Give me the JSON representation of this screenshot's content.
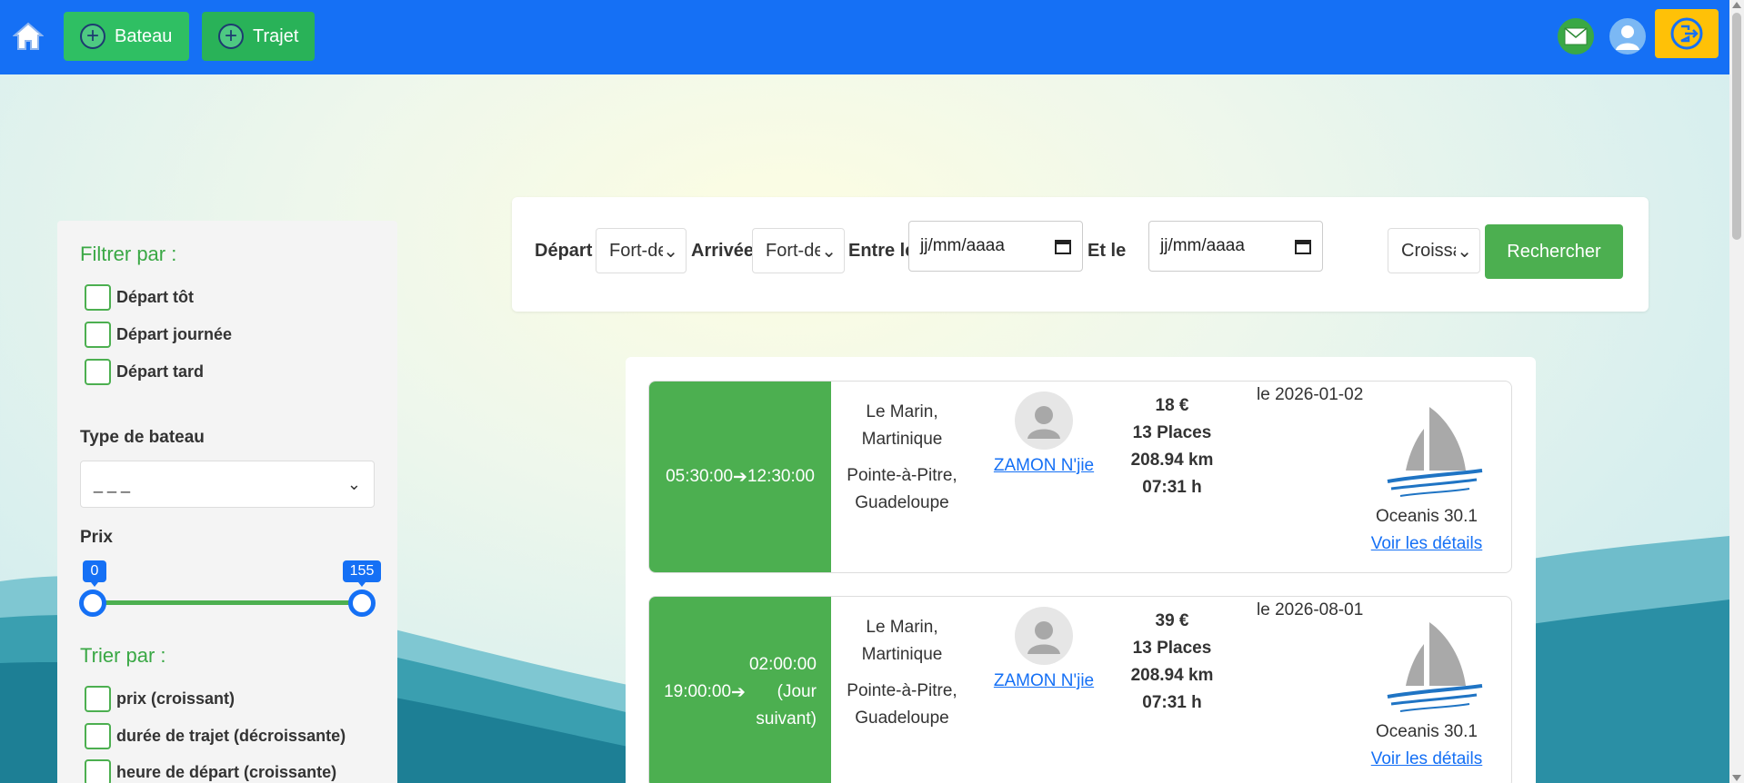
{
  "nav": {
    "bateau_label": "Bateau",
    "trajet_label": "Trajet"
  },
  "filters": {
    "title": "Filtrer par :",
    "checks": [
      "Départ tôt",
      "Départ journée",
      "Départ tard"
    ],
    "boat_type_label": "Type de bateau",
    "boat_type_value": "_ _ _",
    "price_label": "Prix",
    "price_min": "0",
    "price_max": "155"
  },
  "sort": {
    "title": "Trier par :",
    "checks": [
      "prix (croissant)",
      "durée de trajet (décroissante)",
      "heure de départ (croissante)"
    ]
  },
  "search": {
    "depart_label": "Départ",
    "depart_value": "Fort-de-France",
    "arrivee_label": "Arrivée",
    "arrivee_value": "Fort-de-France",
    "entre_label": "Entre le",
    "date_from_placeholder": "jj/mm/aaaa",
    "et_label": "Et le",
    "date_to_placeholder": "jj/mm/aaaa",
    "sort_value": "Croissant",
    "button_label": "Rechercher"
  },
  "trips": [
    {
      "depart_time": "05:30:00",
      "arrow": "➔",
      "arrival_time": "12:30:00",
      "from_city": "Le Marin,",
      "from_region": "Martinique",
      "to_city": "Pointe-à-Pitre,",
      "to_region": "Guadeloupe",
      "owner": "ZAMON N'jie",
      "price": "18 €",
      "places": "13 Places",
      "distance": "208.94 km",
      "duration": "07:31 h",
      "date": "le 2026-01-02",
      "boat": "Oceanis 30.1",
      "details": "Voir les détails"
    },
    {
      "depart_time": "19:00:00",
      "arrow": "➔",
      "arrival_time": "02:00:00",
      "arrival_note_1": "(Jour",
      "arrival_note_2": "suivant)",
      "from_city": "Le Marin,",
      "from_region": "Martinique",
      "to_city": "Pointe-à-Pitre,",
      "to_region": "Guadeloupe",
      "owner": "ZAMON N'jie",
      "price": "39 €",
      "places": "13 Places",
      "distance": "208.94 km",
      "duration": "07:31 h",
      "date": "le 2026-08-01",
      "boat": "Oceanis 30.1",
      "details": "Voir les détails"
    }
  ],
  "colors": {
    "nav_blue": "#1570f5",
    "green": "#4caf50",
    "yellow": "#ffc107"
  }
}
